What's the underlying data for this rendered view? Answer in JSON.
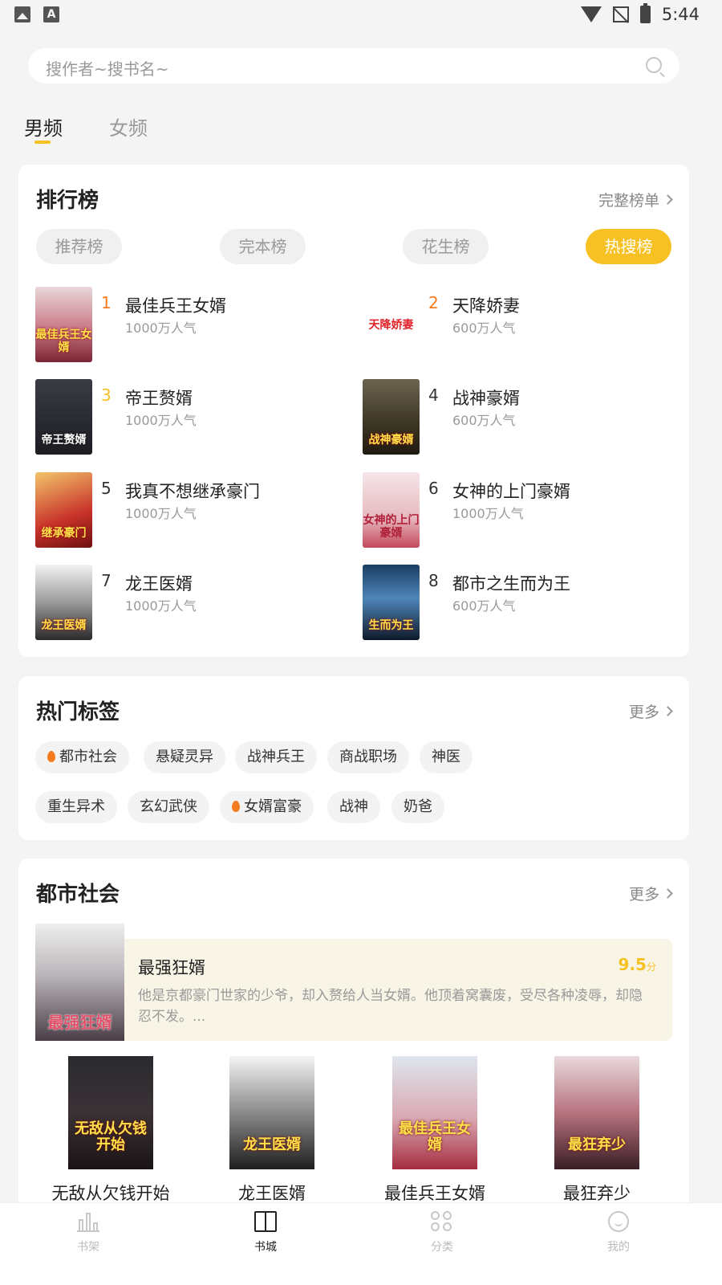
{
  "status_bar": {
    "time": "5:44"
  },
  "search": {
    "placeholder": "搜作者~搜书名~"
  },
  "gender_tabs": [
    {
      "label": "男频",
      "active": true
    },
    {
      "label": "女频",
      "active": false
    }
  ],
  "ranking": {
    "title": "排行榜",
    "more_label": "完整榜单",
    "pills": [
      {
        "label": "推荐榜",
        "active": false
      },
      {
        "label": "完本榜",
        "active": false
      },
      {
        "label": "花生榜",
        "active": false
      },
      {
        "label": "热搜榜",
        "active": true
      }
    ],
    "books": [
      {
        "rank": "1",
        "title": "最佳兵王女婿",
        "popularity": "1000万人气",
        "cover_text": "最佳兵王女婿",
        "rank_color": "#f47b20"
      },
      {
        "rank": "2",
        "title": "天降娇妻",
        "popularity": "600万人气",
        "cover_text": "天降娇妻",
        "rank_color": "#f47b20"
      },
      {
        "rank": "3",
        "title": "帝王赘婿",
        "popularity": "1000万人气",
        "cover_text": "帝王赘婿",
        "rank_color": "#f7c023"
      },
      {
        "rank": "4",
        "title": "战神豪婿",
        "popularity": "600万人气",
        "cover_text": "战神豪婿",
        "rank_color": "#333333"
      },
      {
        "rank": "5",
        "title": "我真不想继承豪门",
        "popularity": "1000万人气",
        "cover_text": "继承豪门",
        "rank_color": "#333333"
      },
      {
        "rank": "6",
        "title": "女神的上门豪婿",
        "popularity": "1000万人气",
        "cover_text": "女神的上门豪婿",
        "rank_color": "#333333"
      },
      {
        "rank": "7",
        "title": "龙王医婿",
        "popularity": "1000万人气",
        "cover_text": "龙王医婿",
        "rank_color": "#333333"
      },
      {
        "rank": "8",
        "title": "都市之生而为王",
        "popularity": "600万人气",
        "cover_text": "生而为王",
        "rank_color": "#333333"
      }
    ]
  },
  "hot_tags": {
    "title": "热门标签",
    "more_label": "更多",
    "tags": [
      {
        "label": "都市社会",
        "hot": true
      },
      {
        "label": "悬疑灵异",
        "hot": false
      },
      {
        "label": "战神兵王",
        "hot": false
      },
      {
        "label": "商战职场",
        "hot": false
      },
      {
        "label": "神医",
        "hot": false
      },
      {
        "label": "重生异术",
        "hot": false
      },
      {
        "label": "玄幻武侠",
        "hot": false
      },
      {
        "label": "女婿富豪",
        "hot": true
      },
      {
        "label": "战神",
        "hot": false
      },
      {
        "label": "奶爸",
        "hot": false
      }
    ]
  },
  "urban": {
    "title": "都市社会",
    "more_label": "更多",
    "featured": {
      "title": "最强狂婿",
      "score": "9.5",
      "score_unit": "分",
      "description": "他是京都豪门世家的少爷，却入赘给人当女婿。他顶着窝囊废，受尽各种凌辱，却隐忍不发。...",
      "cover_text": "最强狂婿"
    },
    "books": [
      {
        "title": "无敌从欠钱开始",
        "cover_text": "无敌从欠钱开始"
      },
      {
        "title": "龙王医婿",
        "cover_text": "龙王医婿"
      },
      {
        "title": "最佳兵王女婿",
        "cover_text": "最佳兵王女婿"
      },
      {
        "title": "最狂弃少",
        "cover_text": "最狂弃少"
      }
    ]
  },
  "bottom_nav": [
    {
      "label": "书架",
      "icon": "bookshelf-icon",
      "active": false
    },
    {
      "label": "书城",
      "icon": "book-open-icon",
      "active": true
    },
    {
      "label": "分类",
      "icon": "category-grid-icon",
      "active": false
    },
    {
      "label": "我的",
      "icon": "profile-smile-icon",
      "active": false
    }
  ],
  "colors": {
    "accent": "#f7c023",
    "hot_rank": "#f47b20",
    "background": "#f4f4f4"
  }
}
